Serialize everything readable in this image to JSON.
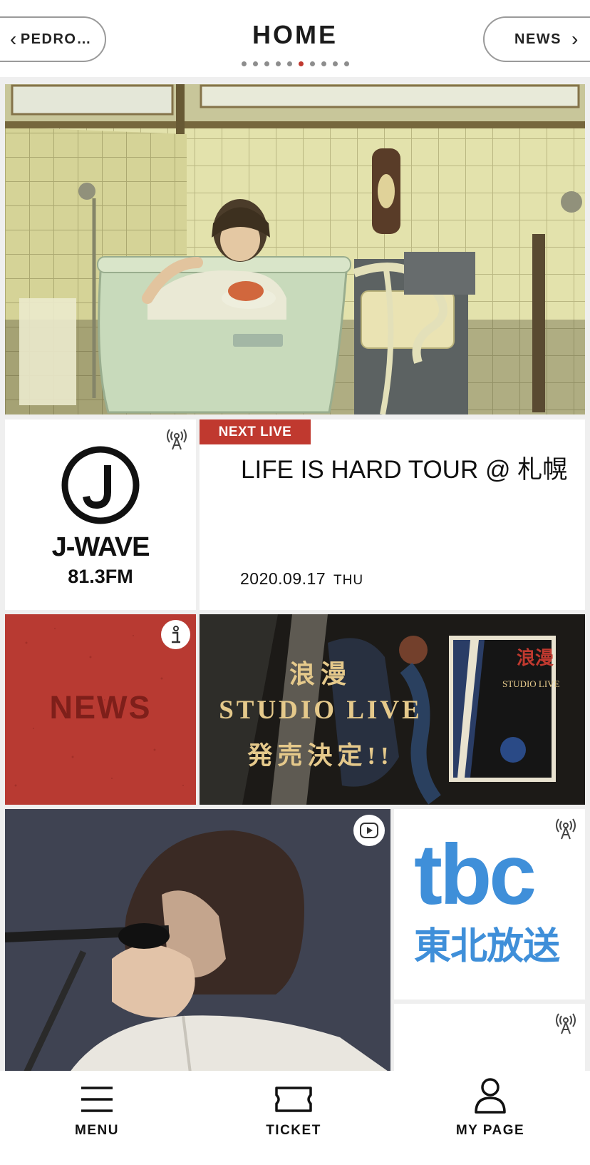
{
  "header": {
    "prev_label": "PEDRO…",
    "title": "HOME",
    "next_label": "NEWS",
    "page_count": 10,
    "active_page": 6
  },
  "tiles": {
    "jwave": {
      "name": "J-WAVE",
      "frequency": "81.3FM",
      "icon": "radio-broadcast-icon"
    },
    "next_live": {
      "badge": "NEXT LIVE",
      "title": "LIFE IS HARD TOUR @ 札幌",
      "date": "2020.09.17",
      "day": "THU"
    },
    "news": {
      "label": "NEWS",
      "icon": "info-icon"
    },
    "studio_live": {
      "line1": "浪漫",
      "line2": "STUDIO LIVE",
      "line3": "発売決定!!",
      "record_title": "浪漫",
      "record_label": "STUDIO LIVE"
    },
    "video": {
      "icon": "play-icon"
    },
    "tbc": {
      "logo": "tbc",
      "subtitle": "東北放送",
      "icon": "radio-broadcast-icon"
    }
  },
  "tabbar": {
    "menu": "MENU",
    "ticket": "TICKET",
    "my_page": "MY PAGE"
  },
  "colors": {
    "accent_red": "#c0392f",
    "tbc_blue": "#3f8fd9",
    "studio_gold": "#e5c98b"
  }
}
